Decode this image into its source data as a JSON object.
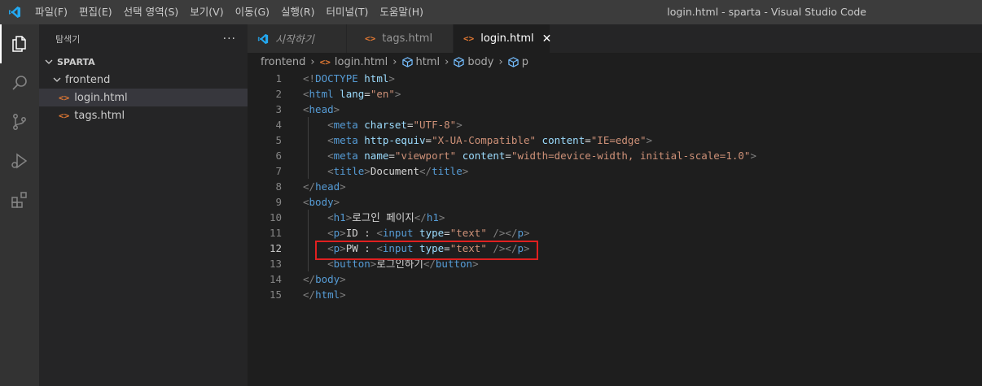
{
  "menu": [
    "파일(F)",
    "편집(E)",
    "선택 영역(S)",
    "보기(V)",
    "이동(G)",
    "실행(R)",
    "터미널(T)",
    "도움말(H)"
  ],
  "window_title": "login.html - sparta - Visual Studio Code",
  "sidebar": {
    "title": "탐색기",
    "more": "···",
    "root": "SPARTA",
    "folder": "frontend",
    "files": [
      {
        "name": "login.html",
        "icon": "<>"
      },
      {
        "name": "tags.html",
        "icon": "<>"
      }
    ]
  },
  "tabs": [
    {
      "label": "시작하기"
    },
    {
      "label": "tags.html",
      "icon": "<>"
    },
    {
      "label": "login.html",
      "icon": "<>",
      "close": "✕"
    }
  ],
  "breadcrumb": {
    "items": [
      "frontend",
      "login.html",
      "html",
      "body",
      "p"
    ],
    "icons": [
      "",
      "<>"
    ],
    "sep": "›"
  },
  "code": {
    "current_line": 12,
    "line_numbers": [
      "1",
      "2",
      "3",
      "4",
      "5",
      "6",
      "7",
      "8",
      "9",
      "10",
      "11",
      "12",
      "13",
      "14",
      "15"
    ]
  },
  "colors": {
    "tag": "#569cd6",
    "attribute": "#9cdcfe",
    "string": "#ce9178",
    "punctuation": "#808080",
    "text": "#d4d4d4",
    "highlight_border": "#e02020",
    "vscode_blue": "#23a9f2"
  }
}
